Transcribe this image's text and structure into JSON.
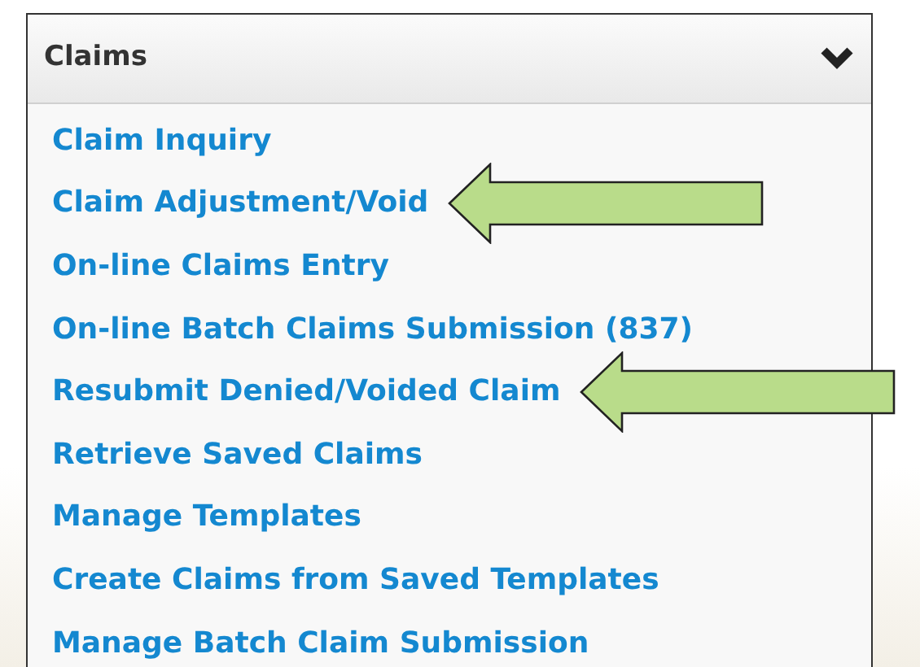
{
  "panel": {
    "title": "Claims",
    "expanded": true,
    "items": [
      {
        "label": "Claim Inquiry",
        "arrow": false
      },
      {
        "label": "Claim Adjustment/Void",
        "arrow": true
      },
      {
        "label": "On-line Claims Entry",
        "arrow": false
      },
      {
        "label": "On-line Batch Claims Submission (837)",
        "arrow": false
      },
      {
        "label": "Resubmit Denied/Voided Claim",
        "arrow": true
      },
      {
        "label": "Retrieve Saved Claims",
        "arrow": false
      },
      {
        "label": "Manage Templates",
        "arrow": false
      },
      {
        "label": "Create Claims from Saved Templates",
        "arrow": false
      },
      {
        "label": "Manage Batch Claim Submission",
        "arrow": false
      }
    ]
  }
}
